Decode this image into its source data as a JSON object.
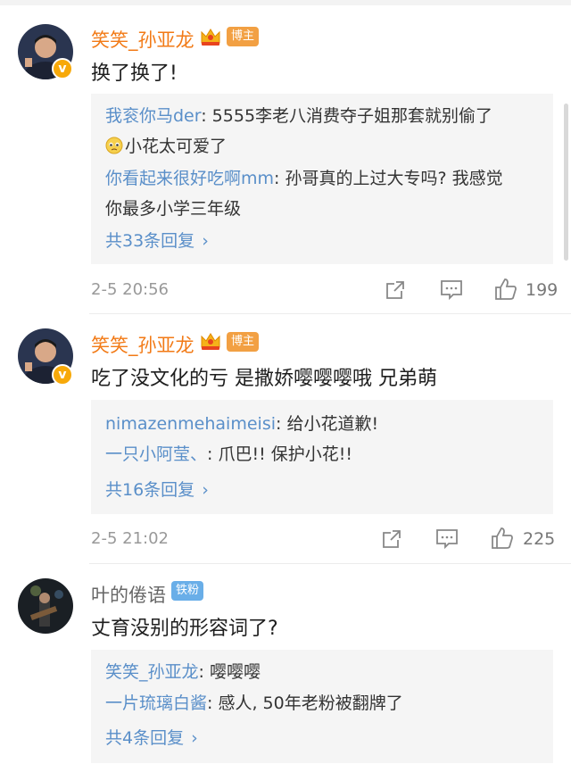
{
  "comments": [
    {
      "username": "笑笑_孙亚龙",
      "badge": "博主",
      "text": "换了换了!",
      "replies": [
        {
          "name": "我衮你马der",
          "text": ": 5555李老八消费夺子姐那套就别偷了",
          "text2": "小花太可爱了"
        },
        {
          "name": "你看起来很好吃啊mm",
          "text": ": 孙哥真的上过大专吗? 我感觉",
          "text2": "你最多小学三年级"
        }
      ],
      "more": "共33条回复",
      "time": "2-5 20:56",
      "likes": "199"
    },
    {
      "username": "笑笑_孙亚龙",
      "badge": "博主",
      "text": "吃了没文化的亏 是撒娇嘤嘤嘤哦 兄弟萌",
      "replies": [
        {
          "name": "nimazenmehaimeisi",
          "text": ": 给小花道歉!"
        },
        {
          "name": "一只小阿莹、",
          "text": ": 爪巴!! 保护小花!!"
        }
      ],
      "more": "共16条回复",
      "time": "2-5 21:02",
      "likes": "225"
    },
    {
      "username": "叶的倦语",
      "badge": "铁粉",
      "text": "丈育没别的形容词了?",
      "replies": [
        {
          "name": "笑笑_孙亚龙",
          "text": ": 嘤嘤嘤"
        },
        {
          "name": "一片琉璃白酱",
          "text": ": 感人, 50年老粉被翻牌了"
        }
      ],
      "more": "共4条回复"
    }
  ],
  "icons": {
    "verified": "v-badge-icon",
    "crown": "crown-icon",
    "share": "share-icon",
    "comment": "comment-icon",
    "like": "thumbs-up-icon",
    "emoji": "pleading-face-icon",
    "chevron": "chevron-right-icon"
  },
  "colors": {
    "vip_name": "#f27a16",
    "reply_name": "#5a8fc9",
    "badge_blogger": "#f2a043",
    "badge_fan": "#69aee8",
    "verified": "#f7a90a"
  }
}
